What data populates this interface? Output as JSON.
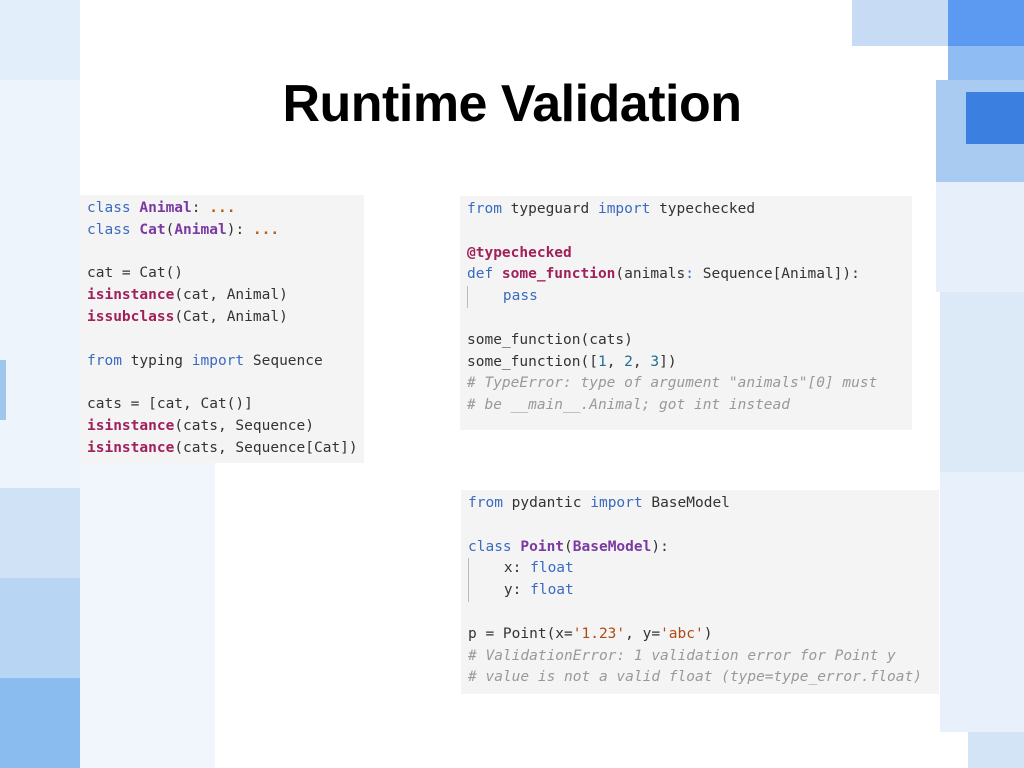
{
  "slide": {
    "title": "Runtime Validation"
  },
  "colors": {
    "deco_blue_light": "#dbe9f7",
    "deco_blue_mid": "#9fc6ef",
    "deco_blue_dark": "#3b7fe0",
    "keyword": "#3a6bc0",
    "function": "#a0205a",
    "class": "#7a3aa0",
    "comment": "#999999"
  },
  "code_left": {
    "lines": [
      [
        [
          "kw",
          "class "
        ],
        [
          "cls",
          "Animal"
        ],
        [
          "p",
          ": "
        ],
        [
          "ell",
          "..."
        ]
      ],
      [
        [
          "kw",
          "class "
        ],
        [
          "cls",
          "Cat"
        ],
        [
          "p",
          "("
        ],
        [
          "cls",
          "Animal"
        ],
        [
          "p",
          "): "
        ],
        [
          "ell",
          "..."
        ]
      ],
      [],
      [
        [
          "p",
          "cat = Cat()"
        ]
      ],
      [
        [
          "kwb",
          "isinstance"
        ],
        [
          "p",
          "(cat, Animal)"
        ]
      ],
      [
        [
          "kwb",
          "issubclass"
        ],
        [
          "p",
          "(Cat, Animal)"
        ]
      ],
      [],
      [
        [
          "kw",
          "from "
        ],
        [
          "p",
          "typing "
        ],
        [
          "kw",
          "import "
        ],
        [
          "p",
          "Sequence"
        ]
      ],
      [],
      [
        [
          "p",
          "cats = [cat, Cat()]"
        ]
      ],
      [
        [
          "kwb",
          "isinstance"
        ],
        [
          "p",
          "(cats, Sequence)"
        ]
      ],
      [
        [
          "kwb",
          "isinstance"
        ],
        [
          "p",
          "(cats, Sequence[Cat])"
        ]
      ]
    ]
  },
  "code_typeguard": {
    "lines": [
      [
        [
          "kw",
          "from "
        ],
        [
          "p",
          "typeguard "
        ],
        [
          "kw",
          "import "
        ],
        [
          "p",
          "typechecked"
        ]
      ],
      [],
      [
        [
          "dec",
          "@typechecked"
        ]
      ],
      [
        [
          "kw",
          "def "
        ],
        [
          "fn",
          "some_function"
        ],
        [
          "p",
          "(animals"
        ],
        [
          "kw",
          ": "
        ],
        [
          "p",
          "Sequence[Animal]):"
        ]
      ],
      [
        [
          "g",
          ""
        ],
        [
          "kw",
          "    pass"
        ]
      ],
      [],
      [
        [
          "p",
          "some_function(cats)"
        ]
      ],
      [
        [
          "p",
          "some_function(["
        ],
        [
          "num",
          "1"
        ],
        [
          "p",
          ", "
        ],
        [
          "num",
          "2"
        ],
        [
          "p",
          ", "
        ],
        [
          "num",
          "3"
        ],
        [
          "p",
          "])"
        ]
      ],
      [
        [
          "com",
          "# TypeError: type of argument \"animals\"[0] must"
        ]
      ],
      [
        [
          "com",
          "# be __main__.Animal; got int instead"
        ]
      ]
    ]
  },
  "code_pydantic": {
    "lines": [
      [
        [
          "kw",
          "from "
        ],
        [
          "p",
          "pydantic "
        ],
        [
          "kw",
          "import "
        ],
        [
          "p",
          "BaseModel"
        ]
      ],
      [],
      [
        [
          "kw",
          "class "
        ],
        [
          "cls",
          "Point"
        ],
        [
          "p",
          "("
        ],
        [
          "cls",
          "BaseModel"
        ],
        [
          "p",
          "):"
        ]
      ],
      [
        [
          "g",
          ""
        ],
        [
          "p",
          "    x: "
        ],
        [
          "kw",
          "float"
        ]
      ],
      [
        [
          "g",
          ""
        ],
        [
          "p",
          "    y: "
        ],
        [
          "kw",
          "float"
        ]
      ],
      [],
      [
        [
          "p",
          "p = Point(x="
        ],
        [
          "str",
          "'1.23'"
        ],
        [
          "p",
          ", y="
        ],
        [
          "str",
          "'abc'"
        ],
        [
          "p",
          ")"
        ]
      ],
      [
        [
          "com",
          "# ValidationError: 1 validation error for Point y"
        ]
      ],
      [
        [
          "com",
          "# value is not a valid float (type=type_error.float)"
        ]
      ]
    ]
  }
}
